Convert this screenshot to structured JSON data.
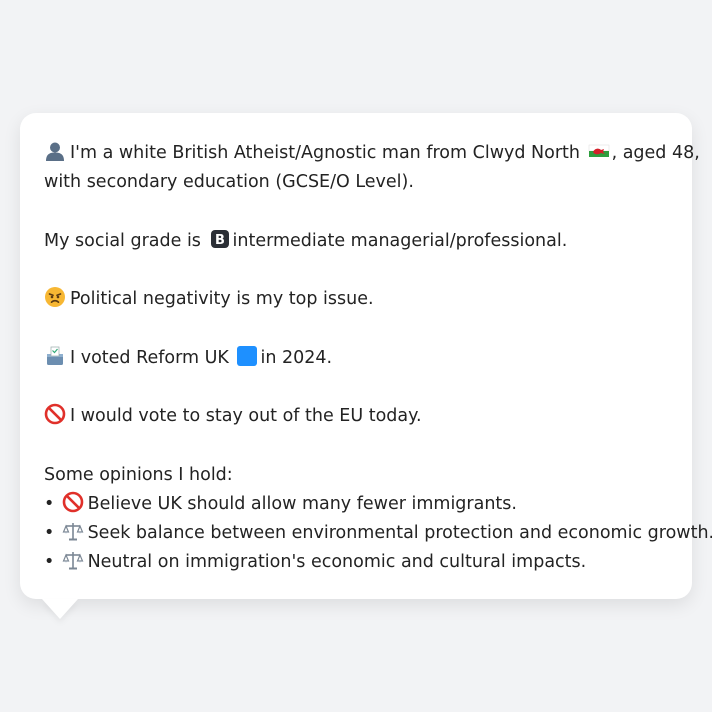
{
  "profile": {
    "intro_part1": "I'm a white British Atheist/Agnostic man from Clwyd North",
    "intro_part2": ", aged 48,",
    "intro_line2": "with secondary education (GCSE/O Level).",
    "social_prefix": "My social grade is",
    "social_suffix": "intermediate managerial/professional.",
    "issue": "Political negativity is my top issue.",
    "vote_prefix": "I voted Reform UK",
    "vote_suffix": "in 2024.",
    "eu": "I would vote to stay out of the EU today.",
    "opinions_heading": "Some opinions I hold:",
    "opinions": [
      {
        "bullet": "•",
        "icon": "no-entry-icon",
        "text": "Believe UK should allow many fewer immigrants."
      },
      {
        "bullet": "•",
        "icon": "scales-icon",
        "text": "Seek balance between environmental protection and economic growth."
      },
      {
        "bullet": "•",
        "icon": "scales-icon",
        "text": "Neutral on immigration's economic and cultural impacts."
      }
    ]
  },
  "icons": {
    "person": "bust-in-silhouette-icon",
    "flag": "wales-flag-icon",
    "grade": "b-button-icon",
    "issue": "angry-face-icon",
    "vote": "ballot-box-icon",
    "party_color": "blue-square-icon",
    "eu": "no-entry-icon"
  },
  "colors": {
    "background": "#f2f3f5",
    "card": "#ffffff",
    "text": "#232323",
    "party_blue": "#1e90ff"
  }
}
